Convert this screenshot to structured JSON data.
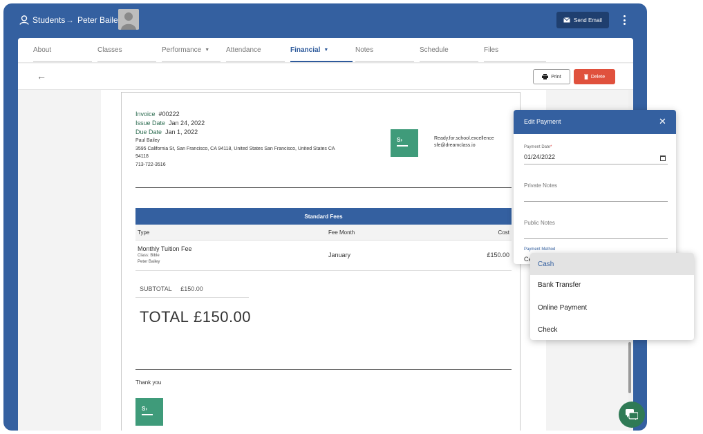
{
  "breadcrumb": {
    "students": "Students",
    "arrow": "→",
    "student_name": "Peter Bailey"
  },
  "header": {
    "send_email": "Send Email"
  },
  "tabs": [
    {
      "label": "About"
    },
    {
      "label": "Classes"
    },
    {
      "label": "Performance",
      "caret": "▼"
    },
    {
      "label": "Attendance"
    },
    {
      "label": "Financial",
      "caret": "▼"
    },
    {
      "label": "Notes"
    },
    {
      "label": "Schedule"
    },
    {
      "label": "Files"
    }
  ],
  "active_tab": "Financial",
  "actions": {
    "back": "←",
    "print": "Print",
    "delete": "Delete"
  },
  "invoice": {
    "invoice_label": "Invoice",
    "invoice_number": "#00222",
    "issue_label": "Issue Date",
    "issue_date": "Jan 24, 2022",
    "due_label": "Due Date",
    "due_date": "Jan 1, 2022",
    "bill_name": "Paul Bailey",
    "address_line1": "3595 California St, San Francisco, CA 94118, United States San Francisco, United States CA",
    "address_line2": "94118",
    "phone": "713-722-3516",
    "logo_text": "S›",
    "contact_line1": "Ready.for.school.excellence",
    "contact_line2": "sfe@dreamclass.io",
    "fees_title": "Standard Fees",
    "columns": {
      "type": "Type",
      "month": "Fee Month",
      "cost": "Cost"
    },
    "rows": [
      {
        "type": "Monthly Tuition Fee",
        "class": "Class: Bible",
        "student": "Peter Bailey",
        "month": "January",
        "cost": "£150.00"
      }
    ],
    "subtotal_label": "SUBTOTAL",
    "subtotal_value": "£150.00",
    "total_label": "TOTAL",
    "total_value": "£150.00",
    "thanks": "Thank you"
  },
  "dialog": {
    "title": "Edit Payment",
    "close": "✕",
    "payment_date_label": "Payment Date",
    "required_mark": "*",
    "payment_date_value": "01/24/2022",
    "private_notes_placeholder": "Private Notes",
    "public_notes_placeholder": "Public Notes",
    "payment_method_label": "Payment Method",
    "payment_method_value": "Ca"
  },
  "dropdown": {
    "selected": "Cash",
    "options": [
      "Cash",
      "Bank Transfer",
      "Online Payment",
      "Check"
    ]
  },
  "colors": {
    "primary": "#3460a0",
    "danger": "#e0513d",
    "brand_green": "#3f9b7a",
    "chat_green": "#2f7a55"
  }
}
